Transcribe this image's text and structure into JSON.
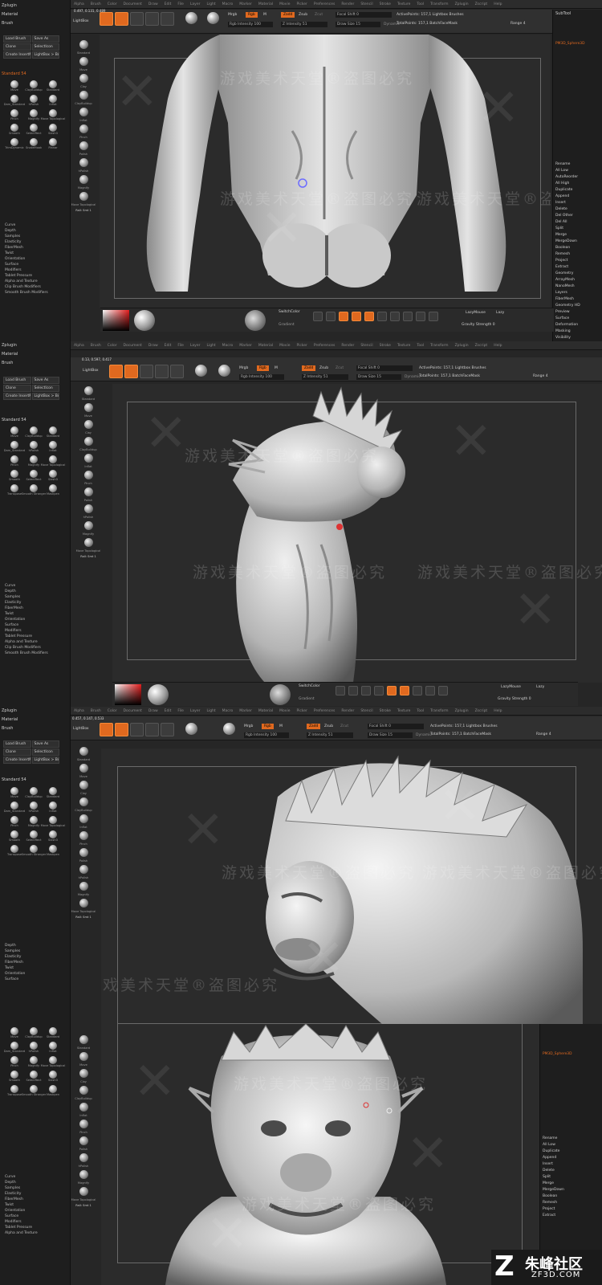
{
  "menu_items": [
    "Alpha",
    "Brush",
    "Color",
    "Document",
    "Draw",
    "Edit",
    "File",
    "Layer",
    "Light",
    "Macro",
    "Marker",
    "Material",
    "Movie",
    "Picker",
    "Preferences",
    "Render",
    "Stencil",
    "Stroke",
    "Texture",
    "Tool",
    "Transform",
    "Zplugin",
    "Zscript",
    "Help"
  ],
  "left_panel": {
    "headers": [
      "Zplugin",
      "Material",
      "Brush"
    ],
    "buttons": [
      "Load Brush",
      "Save As",
      "Clone",
      "SelectIcon",
      "Create InsertMesh",
      "LightBox > Brushes"
    ],
    "brush_current": "Standard 54",
    "brushes": [
      "Move",
      "ClayBuildup",
      "Standard",
      "Dam_Standard",
      "hPolish",
      "Inflat",
      "Pinch",
      "Magnify",
      "Move Topological",
      "Smooth",
      "SelectRect",
      "Slash3",
      "TrimDynamic",
      "SnakeHook",
      "Planar",
      "Transpose",
      "Smooth Stronger",
      "Maskpen",
      "ClipCurve",
      "SliceCurve",
      "MaskLasso"
    ],
    "submenus": [
      "Curve",
      "Depth",
      "Samples",
      "Elasticity",
      "FiberMesh",
      "Twist",
      "Orientation",
      "Surface",
      "Modifiers",
      "Tablet Pressure",
      "Alpha and Texture",
      "Clip Brush Modifiers",
      "Smooth Brush Modifiers"
    ]
  },
  "toolbar": {
    "lightbox": "LightBox",
    "modes": [
      "Edit",
      "Draw",
      "Move",
      "Scale",
      "Rotate"
    ],
    "mrgb": "Mrgb",
    "rgb": "Rgb",
    "m": "M",
    "zadd": "Zadd",
    "zsub": "Zsub",
    "zcut": "Zcut",
    "rgb_intensity": "Rgb Intensity 100",
    "z_intensity": "Z Intensity 51",
    "focal_shift": "Focal Shift 0",
    "draw_size": "Draw Size 15",
    "dynamic": "Dynamic",
    "active_points": "ActivePoints: 157,1 Lightbox Brushes",
    "total_points": "TotalPoints: 157,1 BatchFaceMask",
    "range": "Range 4",
    "gyro": "Gyro",
    "sphere": "Sphere3D",
    "coords": [
      "0.497, 0.131, 0.489",
      "0.13, 0.597, 0.417",
      "0.457, 0.147, 0.533"
    ]
  },
  "shelf": {
    "items": [
      "Standard",
      "Move",
      "Clay",
      "ClayBuildup",
      "Inflat",
      "Pinch",
      "Polish",
      "hPolish",
      "Magnify",
      "Move Topological"
    ],
    "footer": "Rall: Smt 1"
  },
  "bottom": {
    "brush_label": "SwitchColor",
    "gradient": "Gradient",
    "lazy_mouse": "LazyMouse",
    "lazy_label": "Lazy",
    "gravity": "Gravity Strength 0",
    "snapshot": "SnapShot3D",
    "backface": "BackFaceMask"
  },
  "right_panel": {
    "subtool": "SubTool",
    "tool_name": "PM3D_Sphere3D",
    "items": [
      "Rename",
      "All Low",
      "AutoReorder",
      "All High",
      "Duplicate",
      "Append",
      "Insert",
      "Delete",
      "Del Other",
      "Del All",
      "Split",
      "Merge",
      "MergeDown",
      "Boolean",
      "Remesh",
      "Project",
      "Extract",
      "Geometry",
      "ArrayMesh",
      "NanoMesh",
      "Layers",
      "FiberMesh",
      "Geometry HD",
      "Preview",
      "Surface",
      "Deformation",
      "Masking",
      "Visibility"
    ]
  },
  "watermark": {
    "text": "游戏美术天堂®盗图必究"
  },
  "logo": {
    "mark": "Z",
    "name": "朱峰社区",
    "url": "ZF3D.COM"
  },
  "colors": {
    "accent": "#e0691f",
    "panel_bg": "#1e1e1e",
    "canvas_bg": "#2b2b2b",
    "sculpt_clay": "#cfcfcf"
  }
}
